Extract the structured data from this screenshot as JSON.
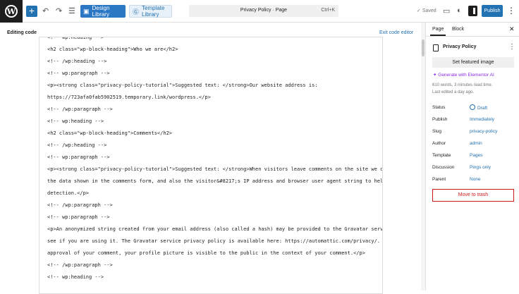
{
  "topbar": {
    "design_library": "Design Library",
    "template_library": "Template Library",
    "document_title": "Privacy Policy · Page",
    "shortcut": "Ctrl+K",
    "saved": "Saved",
    "publish": "Publish"
  },
  "editor": {
    "editing_code": "Editing code",
    "exit_code_editor": "Exit code editor",
    "lines": [
      "<!-- wp:heading -->",
      "<h2 class=\"wp-block-heading\">Who we are</h2>",
      "<!-- /wp:heading -->",
      "<!-- wp:paragraph -->",
      "<p><strong class=\"privacy-policy-tutorial\">Suggested text: </strong>Our website address is:",
      "https://723afa0fab5902519.temporary.link/wordpress.</p>",
      "<!-- /wp:paragraph -->",
      "<!-- wp:heading -->",
      "<h2 class=\"wp-block-heading\">Comments</h2>",
      "<!-- /wp:heading -->",
      "<!-- wp:paragraph -->",
      "<p><strong class=\"privacy-policy-tutorial\">Suggested text: </strong>When visitors leave comments on the site we collect",
      "the data shown in the comments form, and also the visitor&#8217;s IP address and browser user agent string to help spam",
      "detection.</p>",
      "<!-- /wp:paragraph -->",
      "<!-- wp:paragraph -->",
      "<p>An anonymized string created from your email address (also called a hash) may be provided to the Gravatar service to",
      "see if you are using it. The Gravatar service privacy policy is available here: https://automattic.com/privacy/. After",
      "approval of your comment, your profile picture is visible to the public in the context of your comment.</p>",
      "<!-- /wp:paragraph -->",
      "<!-- wp:heading -->"
    ]
  },
  "sidebar": {
    "tab_page": "Page",
    "tab_block": "Block",
    "doc_title": "Privacy Policy",
    "set_featured_image": "Set featured image",
    "generate_ai": "Generate with Elementor AI",
    "meta_words": "610 words, 3 minutes read time.",
    "meta_edited": "Last edited a day ago.",
    "props": [
      {
        "label": "Status",
        "value": "Draft"
      },
      {
        "label": "Publish",
        "value": "Immediately"
      },
      {
        "label": "Slug",
        "value": "privacy-policy"
      },
      {
        "label": "Author",
        "value": "admin"
      },
      {
        "label": "Template",
        "value": "Pages"
      },
      {
        "label": "Discussion",
        "value": "Pings only"
      },
      {
        "label": "Parent",
        "value": "None"
      }
    ],
    "move_to_trash": "Move to trash"
  },
  "colors": {
    "accent": "#2271b1",
    "ai_purple": "#8a2be2",
    "danger": "#cc1818"
  }
}
